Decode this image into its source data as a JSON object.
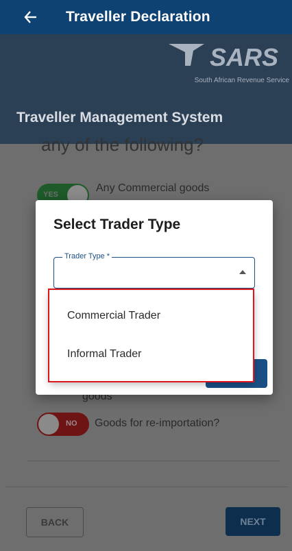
{
  "appbar": {
    "title": "Traveller Declaration"
  },
  "header": {
    "logo_text": "SARS",
    "tagline": "South African Revenue Service",
    "system_title": "Traveller Management System"
  },
  "form": {
    "question_cut": "any of the following?",
    "toggle_yes_label": "YES",
    "commercial_goods_label": "Any Commercial goods",
    "goods_label": "goods",
    "toggle_no_label": "NO",
    "reimport_label": "Goods for re-importation?"
  },
  "dialog": {
    "title": "Select Trader Type",
    "field_label": "Trader Type *",
    "field_value": ""
  },
  "dropdown": {
    "options": [
      "Commercial Trader",
      "Informal Trader"
    ]
  },
  "footer": {
    "back_label": "BACK",
    "next_label": "NEXT"
  },
  "colors": {
    "brand": "#0e4273",
    "highlight": "#e0151b"
  }
}
